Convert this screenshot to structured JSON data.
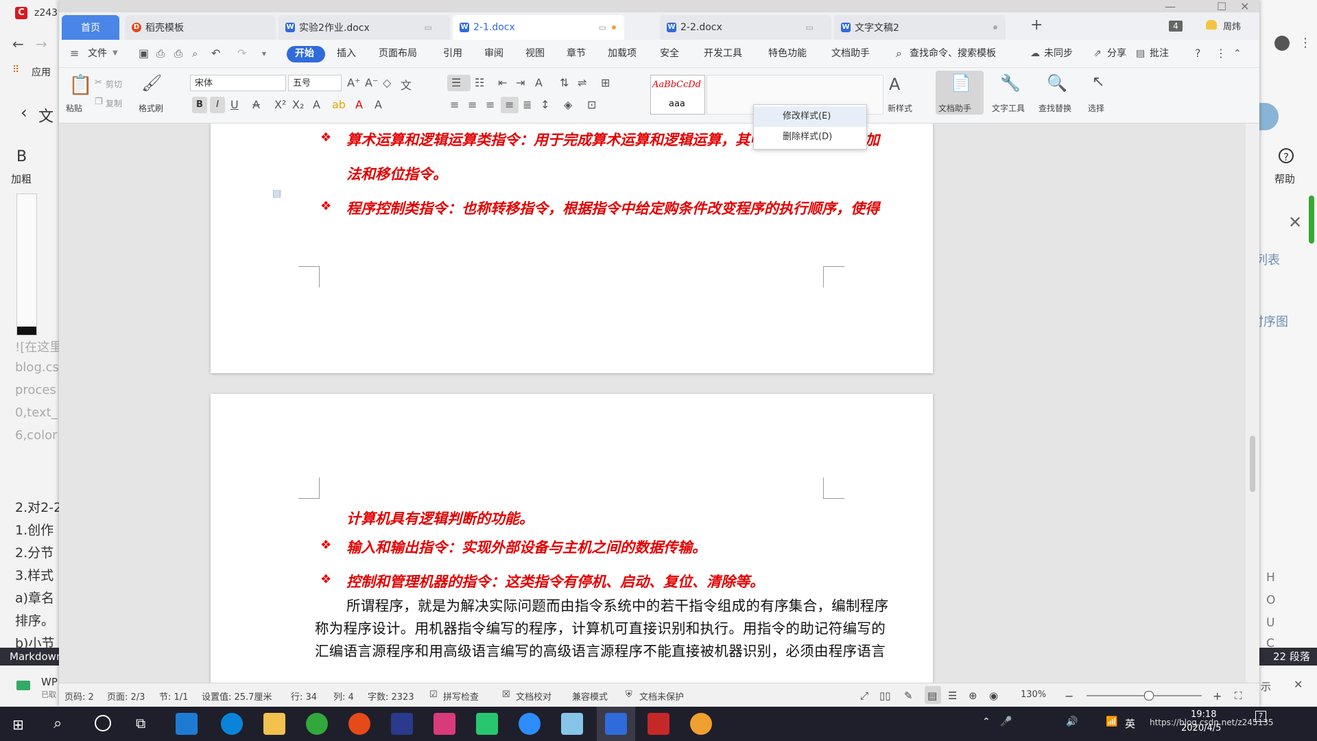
{
  "browser_left": {
    "tab_label": "z243",
    "apps_label": "应用",
    "back_label": "文",
    "bold_label": "B",
    "bold_caption": "加粗",
    "faded_lines": [
      "![在这里",
      "blog.cs",
      "proces",
      "0,text_",
      "6,color"
    ],
    "outline_lines": [
      "2.对2-2",
      "1.创作",
      "2.分节",
      "3.样式",
      "a)章名",
      "排序。",
      "b)小节"
    ],
    "markdown_label": "Markdown",
    "wp_label": "WP",
    "wp_sub": "已取"
  },
  "browser_right": {
    "help_label": "帮助",
    "list_label": "列表",
    "image_label": "时序图",
    "letters": [
      "H",
      "O",
      "U",
      "C"
    ],
    "paragraph_count": "22 段落",
    "display_label": "示"
  },
  "tabs": [
    {
      "label": "首页",
      "active_home": true
    },
    {
      "label": "稻壳模板"
    },
    {
      "label": "实验2作业.docx"
    },
    {
      "label": "2-1.docx",
      "active": true
    },
    {
      "label": "2-2.docx"
    },
    {
      "label": "文字文稿2"
    }
  ],
  "tab_count": "4",
  "user_name": "周炜",
  "menu": {
    "file": "文件",
    "items": [
      "开始",
      "插入",
      "页面布局",
      "引用",
      "审阅",
      "视图",
      "章节",
      "加载项",
      "安全",
      "开发工具",
      "特色功能",
      "文档助手"
    ],
    "search": "查找命令、搜索模板",
    "sync": "未同步",
    "share": "分享",
    "annotate": "批注"
  },
  "toolbar": {
    "paste": "粘贴",
    "cut": "剪切",
    "copy": "复制",
    "format_painter": "格式刷",
    "font_name": "宋体",
    "font_size": "五号",
    "style_preview": "AaBbCcDd",
    "style_name": "aaa",
    "new_style": "新样式",
    "doc_assistant": "文档助手",
    "text_tools": "文字工具",
    "find_replace": "查找替换",
    "select": "选择"
  },
  "context_menu": {
    "modify": "修改样式(E)",
    "delete": "删除样式(D)"
  },
  "document": {
    "page1_lines": [
      "算术运算和逻辑运算类指令：用于完成算术运算和逻辑运算，其中最基本的指令是加",
      "法和移位指令。",
      "程序控制类指令：也称转移指令，根据指令中给定购条件改变程序的执行顺序，使得"
    ],
    "page2_lines": [
      "计算机具有逻辑判断的功能。",
      "输入和输出指令：实现外部设备与主机之间的数据传输。",
      "控制和管理机器的指令：这类指令有停机、启动、复位、清除等。"
    ],
    "body_lines": [
      "所谓程序，就是为解决实际问题而由指令系统中的若干指令组成的有序集合，编制程序",
      "称为程序设计。用机器指令编写的程序，计算机可直接识别和执行。用指令的助记符编写的",
      "汇编语言源程序和用高级语言编写的高级语言源程序不能直接被机器识别，必须由程序语言"
    ]
  },
  "status": {
    "line_no": "页码: 2",
    "page": "页面: 2/3",
    "section": "节: 1/1",
    "setting": "设置值: 25.7厘米",
    "row": "行: 34",
    "col": "列: 4",
    "words": "字数: 2323",
    "spell": "拼写检查",
    "proof": "文档校对",
    "compat": "兼容模式",
    "protect": "文档未保护",
    "zoom": "130%"
  },
  "taskbar": {
    "time": "19:18",
    "date": "2020/4/5",
    "ime": "英",
    "url": "https://blog.csdn.net/z245135",
    "notify_count": "7"
  },
  "colors": {
    "accent": "#2f6bdb",
    "doc_red": "#e40000",
    "start_tab": "#2f6bdb"
  }
}
